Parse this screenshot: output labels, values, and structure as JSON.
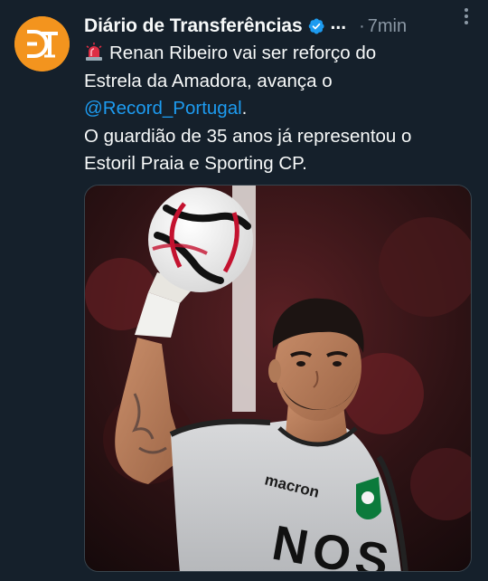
{
  "author": {
    "display_name": "Diário de Transferências",
    "truncation": "...",
    "separator": "·",
    "time": "7min",
    "avatar_icon": "dt-logo",
    "avatar_color": "#f3941e"
  },
  "tweet": {
    "line1": "Renan Ribeiro vai ser reforço do",
    "line2": "Estrela da Amadora, avança o",
    "mention": "@Record_Portugal",
    "mention_suffix": ".",
    "line4": "O guardião de 35 anos já representou o",
    "line5": "Estoril Praia e Sporting CP."
  },
  "media": {
    "jersey_sponsor": "macron",
    "jersey_main_sponsor": "NOS"
  },
  "colors": {
    "background": "#15202b",
    "text": "#f7f9f9",
    "secondary_text": "#8b98a5",
    "link": "#1d9bf0",
    "verified": "#1d9bf0"
  }
}
